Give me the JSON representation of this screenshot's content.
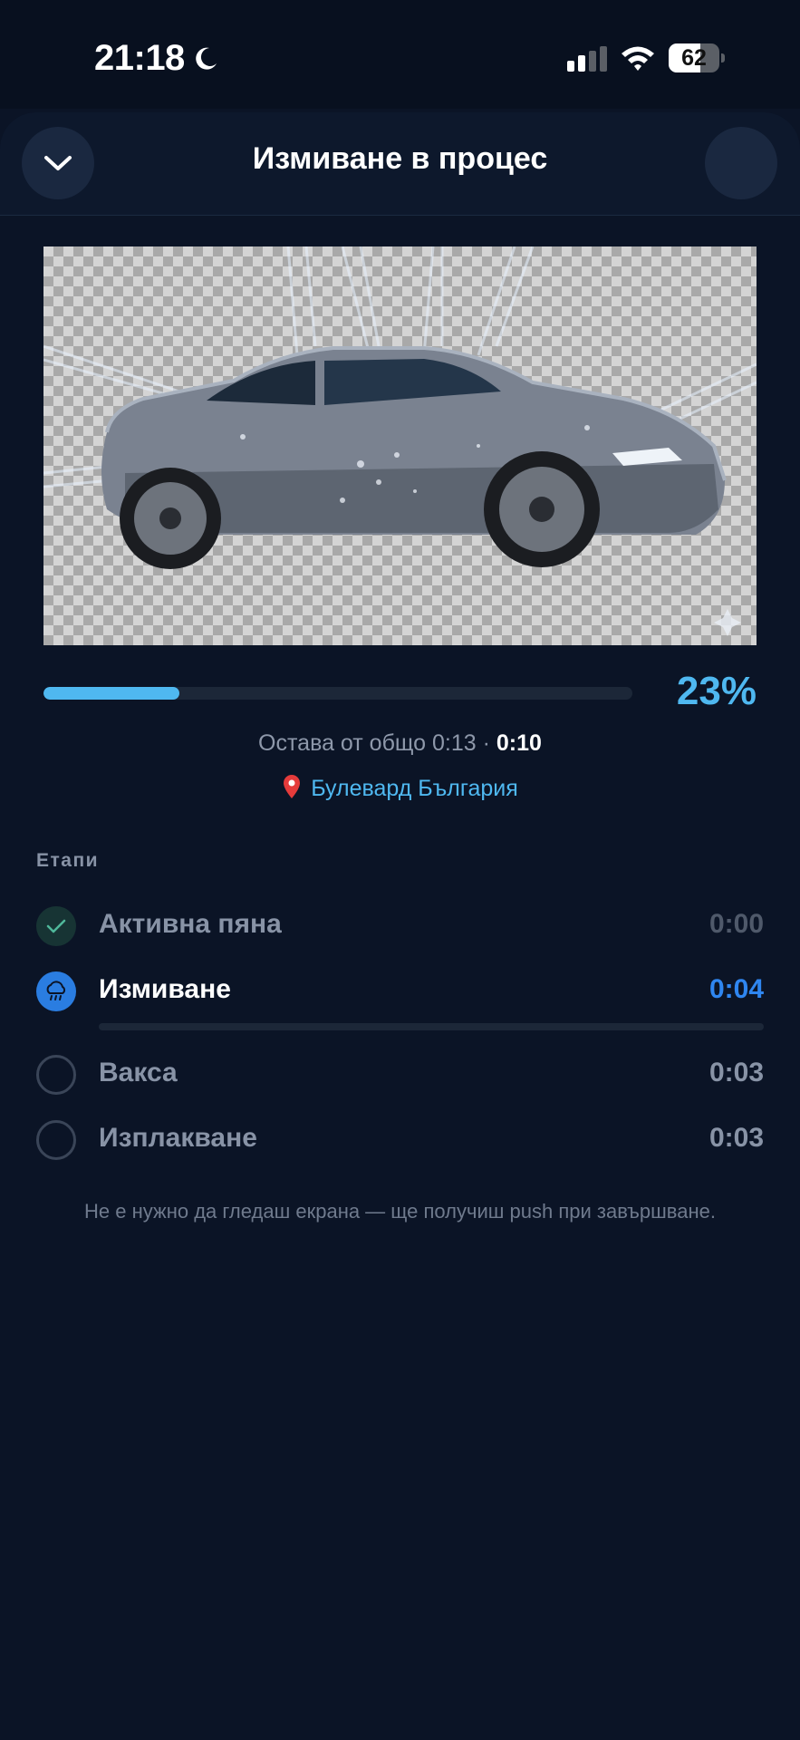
{
  "status_bar": {
    "time": "21:18",
    "battery_level": "62",
    "battery_fraction": 0.62
  },
  "header": {
    "title": "Измиване в процес",
    "collapse_icon": "chevron-down-icon"
  },
  "car_image": {
    "subject": "car-wash-image"
  },
  "progress": {
    "percent_label": "23%",
    "fraction": 0.23,
    "color": "#4fb8f0"
  },
  "remaining": {
    "label": "Остава от общо 0:13 · ",
    "value": "0:10"
  },
  "location": {
    "icon": "map-pin-icon",
    "name": "Булевард България"
  },
  "stages": {
    "heading": "Етапи",
    "items": [
      {
        "name": "Активна пяна",
        "time": "0:00",
        "state": "done",
        "icon": "check-icon"
      },
      {
        "name": "Измиване",
        "time": "0:04",
        "state": "active",
        "icon": "rain-cloud-icon",
        "progress_fraction": 0.0
      },
      {
        "name": "Вакса",
        "time": "0:03",
        "state": "pending",
        "icon": "empty-circle-icon"
      },
      {
        "name": "Изплакване",
        "time": "0:03",
        "state": "pending",
        "icon": "empty-circle-icon"
      }
    ]
  },
  "footer_note": "Не е нужно да гледаш екрана — ще получиш push при завършване.",
  "colors": {
    "background": "#0b1426",
    "accent": "#4fb8f0",
    "active_blue": "#2a7de1",
    "done_green": "#173434"
  }
}
